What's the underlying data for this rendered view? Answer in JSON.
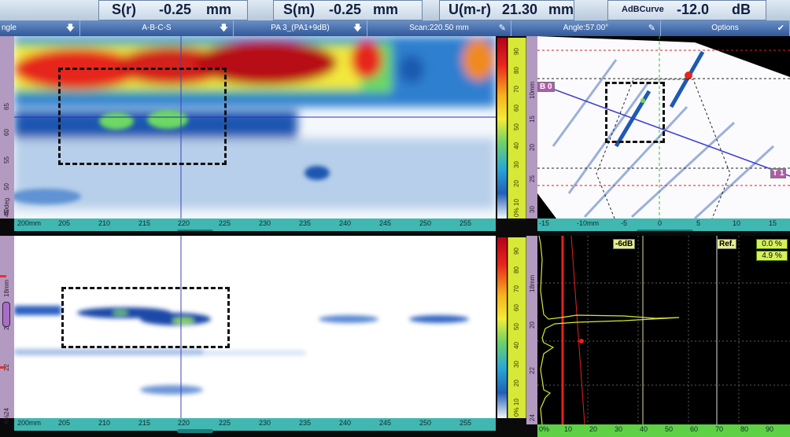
{
  "readouts": {
    "s_r": {
      "label": "S(r)",
      "value": "-0.25",
      "unit": "mm"
    },
    "s_m": {
      "label": "S(m)",
      "value": "-0.25",
      "unit": "mm"
    },
    "u_mr": {
      "label": "U(m-r)",
      "value": "21.30",
      "unit": "mm"
    },
    "adb": {
      "label": "AdBCurve",
      "value": "-12.0",
      "unit": "dB"
    }
  },
  "menu": [
    {
      "label": "ngle"
    },
    {
      "label": "A-B-C-S"
    },
    {
      "label": "PA 3_(PA1+9dB)"
    },
    {
      "label": "Scan:220.50 mm"
    },
    {
      "label": "Angle:57.00°"
    },
    {
      "label": "Options"
    }
  ],
  "cscan_top": {
    "side_label": "40deg",
    "y_ticks": [
      "65",
      "60",
      "55",
      "50",
      "45"
    ],
    "x_ticks": [
      "200mm",
      "205",
      "210",
      "215",
      "220",
      "225",
      "230",
      "235",
      "240",
      "245",
      "250",
      "255"
    ],
    "gauge_ticks": [
      "90",
      "80",
      "70",
      "60",
      "50",
      "40",
      "30",
      "20",
      "10",
      "0%"
    ]
  },
  "cscan_bottom": {
    "side_label": "A%",
    "y_ticks": [
      "18mm",
      "20",
      "22",
      "24"
    ],
    "x_ticks": [
      "200mm",
      "205",
      "210",
      "215",
      "220",
      "225",
      "230",
      "235",
      "240",
      "245",
      "250",
      "255"
    ],
    "gauge_ticks": [
      "90",
      "80",
      "70",
      "60",
      "50",
      "40",
      "30",
      "20",
      "10",
      "0%"
    ]
  },
  "sscan": {
    "cursor_tags": {
      "b": "B 0",
      "t": "T 1"
    },
    "y_ticks": [
      "10mm",
      "15",
      "20",
      "25",
      "30"
    ],
    "x_ticks": [
      "-15",
      "-10mm",
      "-5",
      "0",
      "5",
      "10",
      "15"
    ]
  },
  "ascan": {
    "tags": {
      "db6": "-6dB",
      "ref": "Ref."
    },
    "pct": [
      "0.0 %",
      "4.9 %"
    ],
    "y_ticks": [
      "18mm",
      "20",
      "22",
      "24"
    ],
    "x_ticks": [
      "0%",
      "10",
      "20",
      "30",
      "40",
      "50",
      "60",
      "70",
      "80",
      "90"
    ]
  },
  "colors": {
    "accent": "#31589a",
    "scale_teal": "#41b7b2",
    "ruler_purple": "#b39ac0",
    "gauge_yellow": "#d8e836"
  }
}
